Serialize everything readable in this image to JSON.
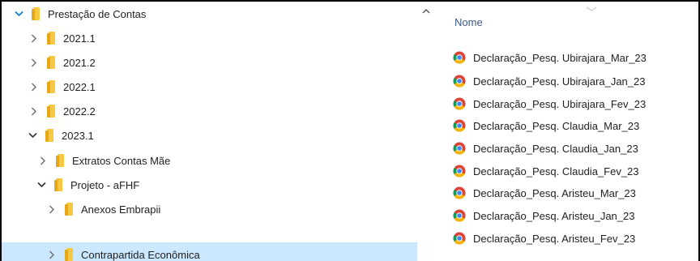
{
  "tree": {
    "nodes": [
      {
        "label": "Prestação de Contas",
        "expanded": true,
        "level": 0
      },
      {
        "label": "2021.1",
        "expanded": false,
        "level": 1
      },
      {
        "label": "2021.2",
        "expanded": false,
        "level": 1
      },
      {
        "label": "2022.1",
        "expanded": false,
        "level": 1
      },
      {
        "label": "2022.2",
        "expanded": false,
        "level": 1
      },
      {
        "label": "2023.1",
        "expanded": true,
        "level": 1
      },
      {
        "label": "Extratos Contas Mãe",
        "expanded": false,
        "level": 2
      },
      {
        "label": "Projeto - aFHF",
        "expanded": true,
        "level": 2
      },
      {
        "label": "Anexos Embrapii",
        "expanded": false,
        "level": 3
      },
      {
        "label": "Contrapartida Econômica",
        "expanded": false,
        "level": 3,
        "selected": true
      }
    ]
  },
  "list": {
    "column_header": "Nome",
    "files": [
      "Declaração_Pesq. Ubirajara_Mar_23",
      "Declaração_Pesq. Ubirajara_Jan_23",
      "Declaração_Pesq. Ubirajara_Fev_23",
      "Declaração_Pesq. Claudia_Mar_23",
      "Declaração_Pesq. Claudia_Jan_23",
      "Declaração_Pesq. Claudia_Fev_23",
      "Declaração_Pesq. Aristeu_Mar_23",
      "Declaração_Pesq. Aristeu_Jan_23",
      "Declaração_Pesq. Aristeu_Fev_23"
    ],
    "file_icon": "chrome-icon"
  },
  "colors": {
    "selection": "#cce8ff",
    "folder": "#f5c945",
    "expanded_chevron": "#0078d4",
    "collapsed_chevron": "#6b6b6b"
  }
}
